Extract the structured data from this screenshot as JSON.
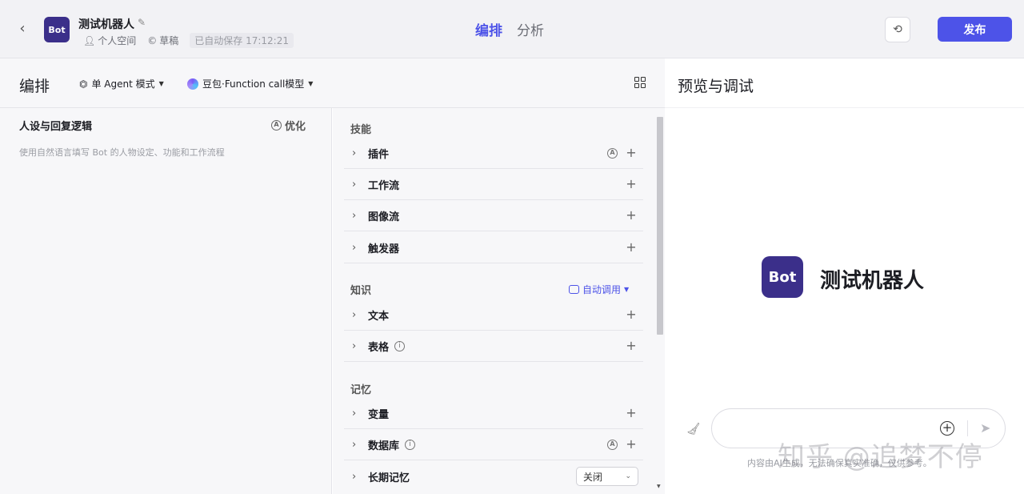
{
  "header": {
    "bot_avatar_text": "Bot",
    "bot_name": "测试机器人",
    "space": "个人空间",
    "status": "草稿",
    "autosave": "已自动保存 17:12:21",
    "tabs": [
      "编排",
      "分析"
    ],
    "active_tab": "编排",
    "publish_label": "发布"
  },
  "editor": {
    "title": "编排",
    "mode": "单 Agent 模式",
    "model": "豆包·Function call模型"
  },
  "persona": {
    "title": "人设与回复逻辑",
    "optimize_label": "优化",
    "placeholder": "使用自然语言填写 Bot 的人物设定、功能和工作流程"
  },
  "skills": {
    "label": "技能",
    "items": [
      "插件",
      "工作流",
      "图像流",
      "触发器"
    ]
  },
  "knowledge": {
    "label": "知识",
    "auto_call": "自动调用",
    "items": [
      "文本",
      "表格"
    ]
  },
  "memory": {
    "label": "记忆",
    "items": [
      "变量",
      "数据库",
      "长期记忆"
    ],
    "long_term_value": "关闭"
  },
  "preview": {
    "title": "预览与调试",
    "avatar_text": "Bot",
    "bot_name": "测试机器人",
    "disclaimer": "内容由AI生成，无法确保真实准确，仅供参考。",
    "watermark": "知乎 @追梦不停"
  },
  "colors": {
    "accent": "#4d53e8",
    "avatar": "#3b2f8a"
  }
}
